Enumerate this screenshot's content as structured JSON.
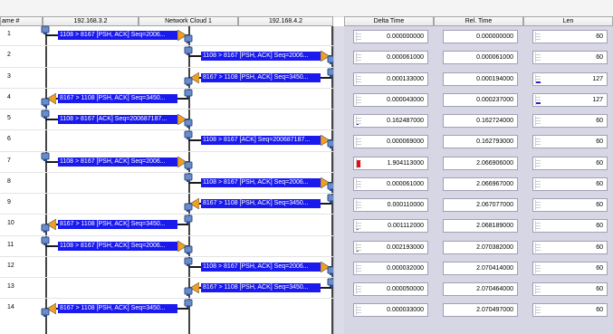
{
  "columns": {
    "frame": "ame #",
    "host_a": "192.168.3.2",
    "cloud": "Network Cloud 1",
    "host_b": "192.168.4.2",
    "delta": "Delta Time",
    "rel": "Rel. Time",
    "len": "Len"
  },
  "colors": {
    "arrow_label_bg": "#1a1aee",
    "bar_normal": "#2323cc",
    "bar_alert": "#dd1111",
    "bar_small": "#22aa22",
    "arrowhead": "#f0a020"
  },
  "rows": [
    {
      "no": "1",
      "label": "1108 > 8167 [PSH, ACK] Seq=2006...",
      "dir": "a2c",
      "delta": "0.000000000",
      "rel": "0.000000000",
      "len": "60",
      "delta_bar": 0,
      "len_bar": 0
    },
    {
      "no": "2",
      "label": "1108 > 8167 [PSH, ACK] Seq=2006...",
      "dir": "c2b",
      "delta": "0.000061000",
      "rel": "0.000061000",
      "len": "60",
      "delta_bar": 0,
      "len_bar": 0
    },
    {
      "no": "3",
      "label": "8167 > 1108 [PSH, ACK] Seq=3450...",
      "dir": "b2c",
      "delta": "0.000133000",
      "rel": "0.000194000",
      "len": "127",
      "delta_bar": 0,
      "len_bar": 0.5
    },
    {
      "no": "4",
      "label": "8167 > 1108 [PSH, ACK] Seq=3450...",
      "dir": "c2a",
      "delta": "0.000043000",
      "rel": "0.000237000",
      "len": "127",
      "delta_bar": 0,
      "len_bar": 0.5
    },
    {
      "no": "5",
      "label": "1108 > 8167 [ACK] Seq=200687187...",
      "dir": "a2c",
      "delta": "0.162487000",
      "rel": "0.162724000",
      "len": "60",
      "delta_bar": 0.085,
      "len_bar": 0
    },
    {
      "no": "6",
      "label": "1108 > 8167 [ACK] Seq=200687187...",
      "dir": "c2b",
      "delta": "0.000069000",
      "rel": "0.162793000",
      "len": "60",
      "delta_bar": 0,
      "len_bar": 0
    },
    {
      "no": "7",
      "label": "1108 > 8167 [PSH, ACK] Seq=2006...",
      "dir": "a2c",
      "delta": "1.904113000",
      "rel": "2.066906000",
      "len": "60",
      "delta_bar": 1.0,
      "len_bar": 0
    },
    {
      "no": "8",
      "label": "1108 > 8167 [PSH, ACK] Seq=2006...",
      "dir": "c2b",
      "delta": "0.000061000",
      "rel": "2.066967000",
      "len": "60",
      "delta_bar": 0,
      "len_bar": 0
    },
    {
      "no": "9",
      "label": "8167 > 1108 [PSH, ACK] Seq=3450...",
      "dir": "b2c",
      "delta": "0.000110000",
      "rel": "2.067077000",
      "len": "60",
      "delta_bar": 0,
      "len_bar": 0
    },
    {
      "no": "10",
      "label": "8167 > 1108 [PSH, ACK] Seq=3450...",
      "dir": "c2a",
      "delta": "0.001112000",
      "rel": "2.068189000",
      "len": "60",
      "delta_bar": 0.02,
      "len_bar": 0
    },
    {
      "no": "11",
      "label": "1108 > 8167 [PSH, ACK] Seq=2006...",
      "dir": "a2c",
      "delta": "0.002193000",
      "rel": "2.070382000",
      "len": "60",
      "delta_bar": 0.02,
      "len_bar": 0
    },
    {
      "no": "12",
      "label": "1108 > 8167 [PSH, ACK] Seq=2006...",
      "dir": "c2b",
      "delta": "0.000032000",
      "rel": "2.070414000",
      "len": "60",
      "delta_bar": 0,
      "len_bar": 0
    },
    {
      "no": "13",
      "label": "8167 > 1108 [PSH, ACK] Seq=3450...",
      "dir": "b2c",
      "delta": "0.000050000",
      "rel": "2.070464000",
      "len": "60",
      "delta_bar": 0,
      "len_bar": 0
    },
    {
      "no": "14",
      "label": "8167 > 1108 [PSH, ACK] Seq=3450...",
      "dir": "c2a",
      "delta": "0.000033000",
      "rel": "2.070497000",
      "len": "60",
      "delta_bar": 0,
      "len_bar": 0
    }
  ]
}
